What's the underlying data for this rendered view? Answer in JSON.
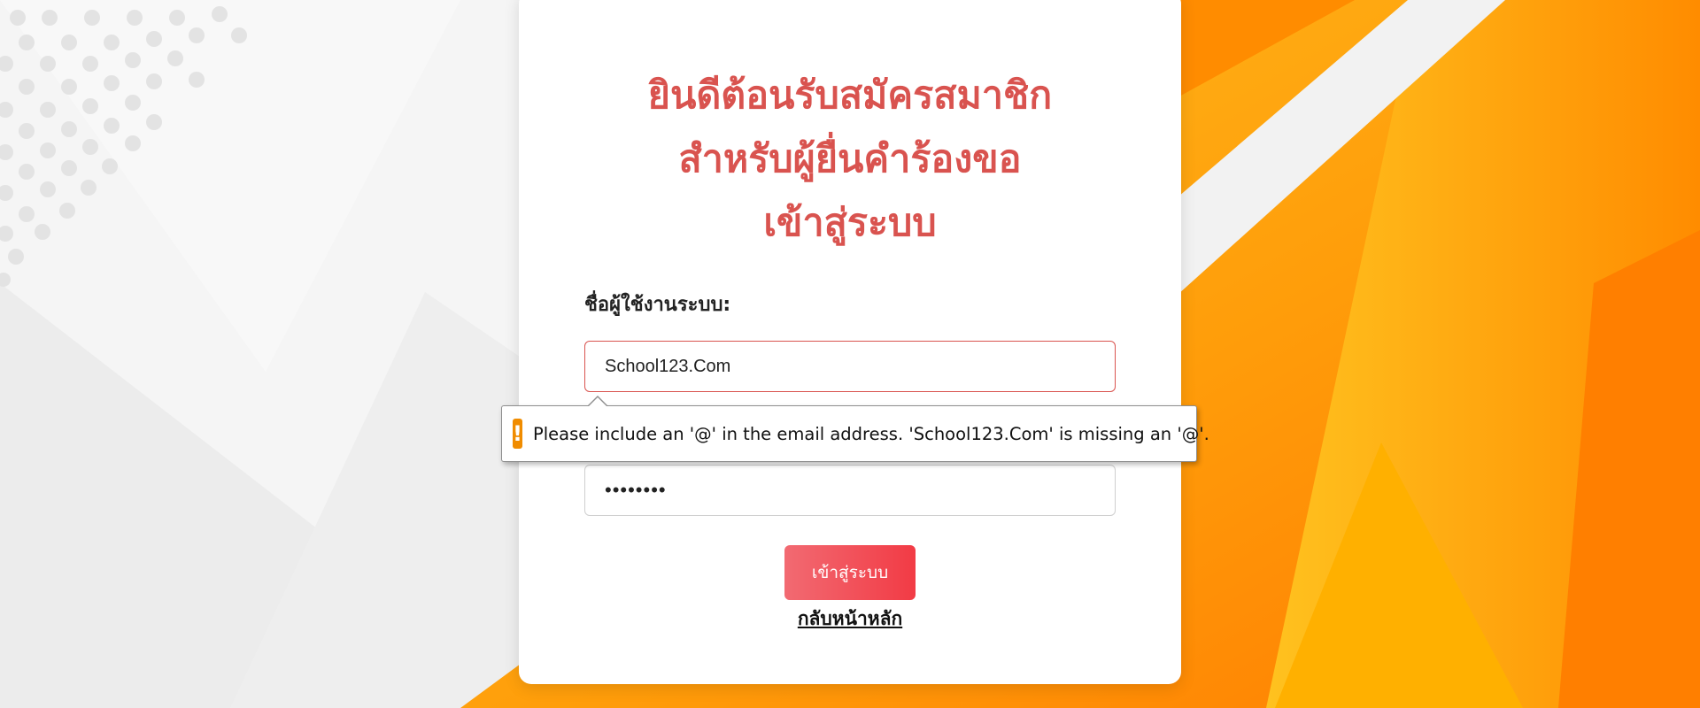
{
  "page": {
    "title_lines": [
      "ยินดีต้อนรับสมัครสมาชิก",
      "สำหรับผู้ยื่นคำร้องขอ",
      "เข้าสู่ระบบ"
    ]
  },
  "form": {
    "username_label": "ชื่อผู้ใช้งานระบบ:",
    "username_value": "School123.Com",
    "password_value": "••••••••",
    "submit_label": "เข้าสู่ระบบ",
    "back_link": "กลับหน้าหลัก"
  },
  "validation": {
    "message": "Please include an '@' in the email address. 'School123.Com' is missing an '@'.",
    "icon": "!"
  },
  "colors": {
    "title": "#d9534f",
    "button_start": "#f26a72",
    "button_end": "#f23b45",
    "warning": "#f08c00",
    "bg_orange": "#ff9d0a"
  },
  "icons": {
    "validation_icon": "warning-icon"
  }
}
